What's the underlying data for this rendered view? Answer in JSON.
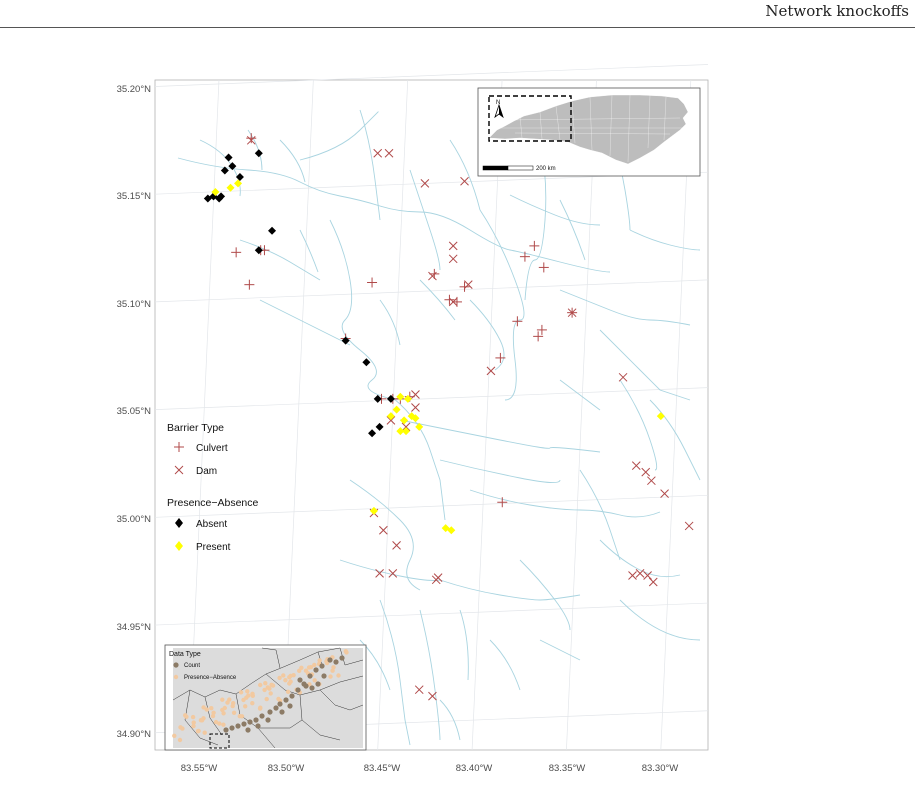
{
  "header": {
    "title": "Network knockoffs"
  },
  "colors": {
    "stream": "#a9d4e0",
    "barrier": "#b04a4a",
    "absent": "#000000",
    "present": "#ffff00",
    "graticule": "#e3e6ea",
    "count": "#8c7b66",
    "presence_absence": "#f2c9a0",
    "state": "#bdbdbd",
    "inset_bg": "#dcdcdc"
  },
  "axes": {
    "lat_labels": [
      "35.20°N",
      "35.15°N",
      "35.10°N",
      "35.05°N",
      "35.00°N",
      "34.95°N",
      "34.90°N"
    ],
    "lon_labels": [
      "83.55°W",
      "83.50°W",
      "83.45°W",
      "83.40°W",
      "83.35°W",
      "83.30°W"
    ]
  },
  "legend": {
    "barrier_title": "Barrier Type",
    "barrier_items": [
      {
        "label": "Culvert",
        "symbol": "plus"
      },
      {
        "label": "Dam",
        "symbol": "cross"
      }
    ],
    "presence_title": "Presence−Absence",
    "presence_items": [
      {
        "label": "Absent",
        "symbol": "diamond-black"
      },
      {
        "label": "Present",
        "symbol": "diamond-yellow"
      }
    ]
  },
  "locator_inset": {
    "north_label": "N",
    "scale_label": "200 km"
  },
  "data_inset": {
    "title": "Data Type",
    "items": [
      {
        "label": "Count",
        "symbol": "circle-dark"
      },
      {
        "label": "Presence−Absence",
        "symbol": "circle-light"
      }
    ]
  },
  "map_data": {
    "bbox_lon": [
      -83.568,
      -83.275
    ],
    "bbox_lat": [
      34.892,
      35.203
    ],
    "culverts": [
      [
        -83.517,
        35.176
      ],
      [
        -83.525,
        35.123
      ],
      [
        -83.512,
        35.124
      ],
      [
        -83.518,
        35.108
      ],
      [
        -83.51,
        35.124
      ],
      [
        -83.467,
        35.083
      ],
      [
        -83.453,
        35.109
      ],
      [
        -83.42,
        35.113
      ],
      [
        -83.408,
        35.1
      ],
      [
        -83.412,
        35.101
      ],
      [
        -83.404,
        35.107
      ],
      [
        -83.376,
        35.091
      ],
      [
        -83.363,
        35.087
      ],
      [
        -83.365,
        35.084
      ],
      [
        -83.367,
        35.126
      ],
      [
        -83.372,
        35.121
      ],
      [
        -83.362,
        35.116
      ],
      [
        -83.347,
        35.095
      ],
      [
        -83.385,
        35.074
      ],
      [
        -83.438,
        35.055
      ],
      [
        -83.442,
        35.055
      ],
      [
        -83.448,
        35.055
      ],
      [
        -83.384,
        35.007
      ],
      [
        -83.433,
        35.056
      ]
    ],
    "dams": [
      [
        -83.517,
        35.175
      ],
      [
        -83.45,
        35.169
      ],
      [
        -83.444,
        35.169
      ],
      [
        -83.425,
        35.155
      ],
      [
        -83.404,
        35.156
      ],
      [
        -83.41,
        35.126
      ],
      [
        -83.41,
        35.12
      ],
      [
        -83.421,
        35.112
      ],
      [
        -83.41,
        35.1
      ],
      [
        -83.402,
        35.108
      ],
      [
        -83.347,
        35.095
      ],
      [
        -83.39,
        35.068
      ],
      [
        -83.32,
        35.065
      ],
      [
        -83.43,
        35.057
      ],
      [
        -83.43,
        35.051
      ],
      [
        -83.443,
        35.045
      ],
      [
        -83.447,
        34.994
      ],
      [
        -83.44,
        34.987
      ],
      [
        -83.449,
        34.974
      ],
      [
        -83.442,
        34.974
      ],
      [
        -83.419,
        34.971
      ],
      [
        -83.418,
        34.972
      ],
      [
        -83.313,
        35.024
      ],
      [
        -83.308,
        35.021
      ],
      [
        -83.305,
        35.017
      ],
      [
        -83.298,
        35.011
      ],
      [
        -83.285,
        34.996
      ],
      [
        -83.315,
        34.973
      ],
      [
        -83.311,
        34.974
      ],
      [
        -83.307,
        34.973
      ],
      [
        -83.304,
        34.97
      ],
      [
        -83.428,
        34.92
      ],
      [
        -83.421,
        34.917
      ],
      [
        -83.452,
        35.002
      ],
      [
        -83.435,
        35.042
      ]
    ],
    "absent": [
      [
        -83.513,
        35.169
      ],
      [
        -83.529,
        35.167
      ],
      [
        -83.527,
        35.163
      ],
      [
        -83.531,
        35.161
      ],
      [
        -83.523,
        35.158
      ],
      [
        -83.533,
        35.149
      ],
      [
        -83.537,
        35.149
      ],
      [
        -83.534,
        35.148
      ],
      [
        -83.54,
        35.148
      ],
      [
        -83.506,
        35.133
      ],
      [
        -83.513,
        35.124
      ],
      [
        -83.467,
        35.082
      ],
      [
        -83.456,
        35.072
      ],
      [
        -83.45,
        35.055
      ],
      [
        -83.453,
        35.039
      ],
      [
        -83.449,
        35.042
      ],
      [
        -83.443,
        35.055
      ]
    ],
    "present": [
      [
        -83.536,
        35.151
      ],
      [
        -83.528,
        35.153
      ],
      [
        -83.524,
        35.155
      ],
      [
        -83.438,
        35.056
      ],
      [
        -83.434,
        35.055
      ],
      [
        -83.44,
        35.05
      ],
      [
        -83.436,
        35.045
      ],
      [
        -83.438,
        35.04
      ],
      [
        -83.43,
        35.046
      ],
      [
        -83.432,
        35.047
      ],
      [
        -83.428,
        35.042
      ],
      [
        -83.435,
        35.04
      ],
      [
        -83.443,
        35.047
      ],
      [
        -83.452,
        35.003
      ],
      [
        -83.414,
        34.995
      ],
      [
        -83.411,
        34.994
      ],
      [
        -83.3,
        35.047
      ]
    ]
  }
}
